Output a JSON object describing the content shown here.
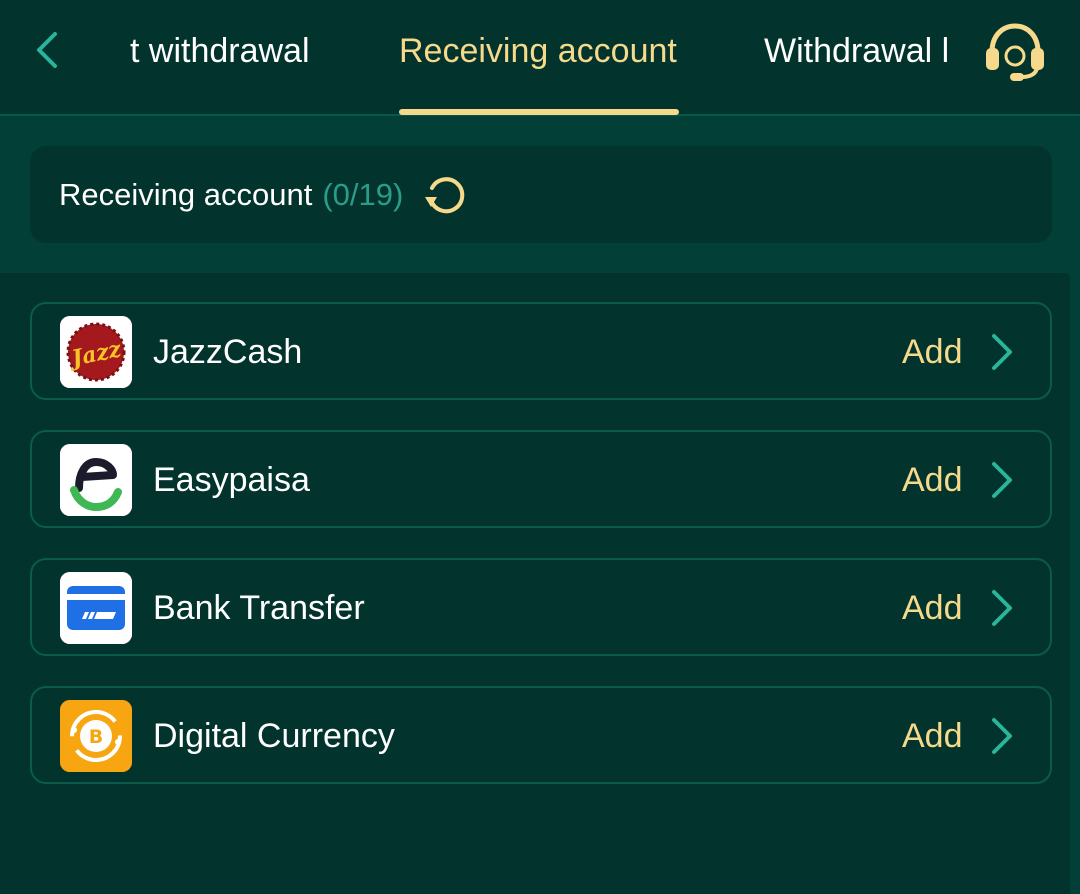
{
  "header": {
    "tabs": [
      {
        "label": "t withdrawal",
        "active": false
      },
      {
        "label": "Receiving account",
        "active": true
      },
      {
        "label": "Withdrawal l",
        "active": false
      }
    ],
    "back_icon": "chevron-left-icon",
    "support_icon": "headset-icon"
  },
  "summary": {
    "title": "Receiving account",
    "count": "(0/19)",
    "refresh_icon": "refresh-icon"
  },
  "methods": [
    {
      "name": "JazzCash",
      "action": "Add",
      "icon": "jazzcash-logo"
    },
    {
      "name": "Easypaisa",
      "action": "Add",
      "icon": "easypaisa-logo"
    },
    {
      "name": "Bank Transfer",
      "action": "Add",
      "icon": "bank-card-icon"
    },
    {
      "name": "Digital Currency",
      "action": "Add",
      "icon": "bitcoin-icon"
    }
  ],
  "colors": {
    "background": "#024037",
    "panel": "#02342d",
    "accent": "#f6d98a",
    "count": "#2a9d8a",
    "border": "#0a5a4e",
    "icon_teal": "#2bb39b"
  }
}
